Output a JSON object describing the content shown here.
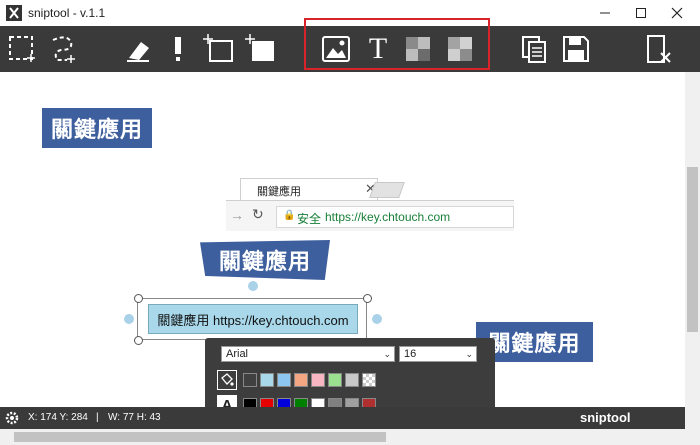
{
  "window": {
    "title": "sniptool - v.1.1"
  },
  "toolbar": {
    "tools": [
      "rect-select",
      "lasso-select",
      "eraser",
      "marker",
      "add-rect-outline",
      "add-rect-filled",
      "image",
      "text",
      "mosaic",
      "blur",
      "copy",
      "save",
      "clear"
    ],
    "text_tool_glyph": "T"
  },
  "canvas": {
    "tag_label": "關鍵應用",
    "browser": {
      "tab_title": "關鍵應用",
      "secure_label": "安全",
      "url": "https://key.chtouch.com"
    },
    "note_text": "關鍵應用 https://key.chtouch.com"
  },
  "panel": {
    "font": "Arial",
    "size": "16",
    "fill_colors": [
      "#404040",
      "#a8d8ea",
      "#8ec6f2",
      "#f4a582",
      "#f7b6c2",
      "#9be08f",
      "#c8c8c8",
      "pattern"
    ],
    "text_colors": [
      "#000000",
      "#e60000",
      "#0000dd",
      "#008000",
      "#ffffff",
      "#808080",
      "#a0a0a0",
      "#b03030"
    ],
    "text_color_glyph": "A"
  },
  "status": {
    "coords": "X: 174 Y: 284",
    "separator": "|",
    "size": "W: 77 H: 43",
    "brand": "sniptool"
  },
  "colors": {
    "toolbar_bg": "#3a3a3a",
    "tag_bg": "#3e5f9e",
    "highlight": "#d8232a"
  }
}
